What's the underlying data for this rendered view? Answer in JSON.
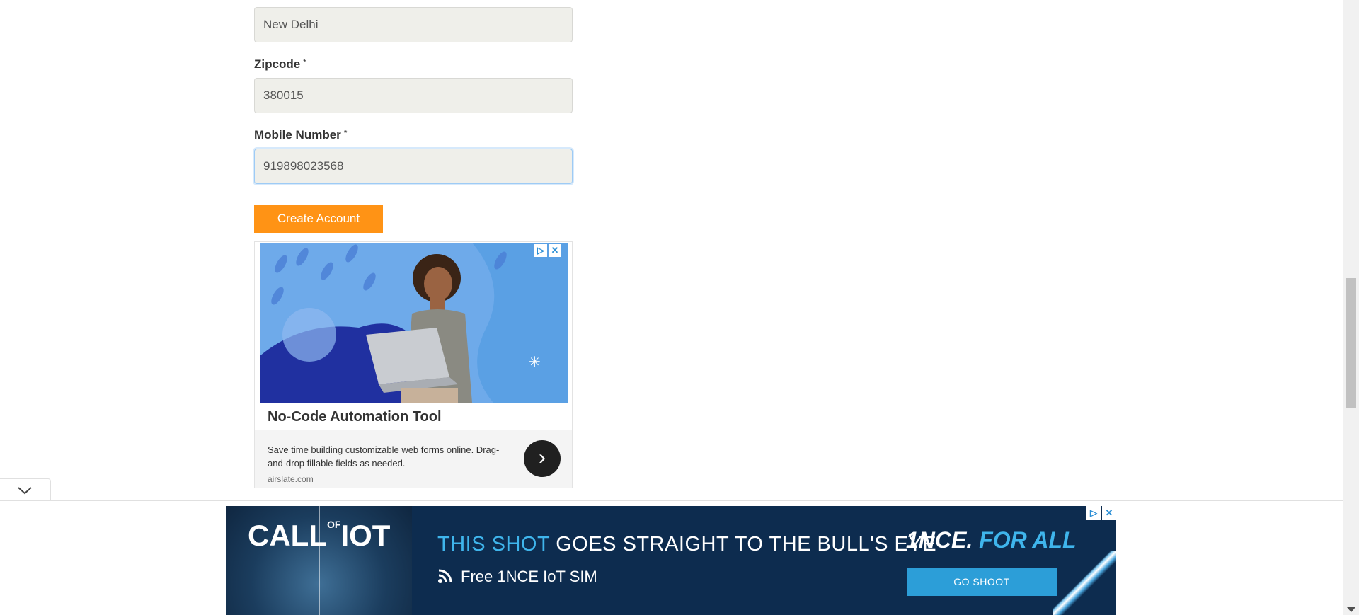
{
  "form": {
    "city_value": "New Delhi",
    "zipcode_label": "Zipcode",
    "zipcode_value": "380015",
    "mobile_label": "Mobile Number",
    "mobile_value": "919898023568",
    "required_marker": "*",
    "create_button": "Create Account"
  },
  "inline_ad": {
    "title": "No-Code Automation Tool",
    "description": "Save time building customizable web forms online. Drag-and-drop fillable fields as needed.",
    "domain": "airslate.com",
    "arrow_icon": "chevron-right-icon",
    "adchoices_icon": "adchoices-icon",
    "close_icon": "close-icon"
  },
  "banner_ad": {
    "logo_main": "CALL",
    "logo_of": "OF",
    "logo_end": "IOT",
    "headline_highlight": "THIS SHOT",
    "headline_rest": " GOES STRAIGHT TO THE BULL'S EYE",
    "subline": "Free 1NCE IoT SIM",
    "brand_main": "1NCE.",
    "brand_for": " FOR ALL",
    "cta": "GO SHOOT"
  },
  "colors": {
    "accent_button": "#ff9315",
    "banner_bg": "#0d2c4f",
    "banner_highlight": "#3fb5ec"
  }
}
